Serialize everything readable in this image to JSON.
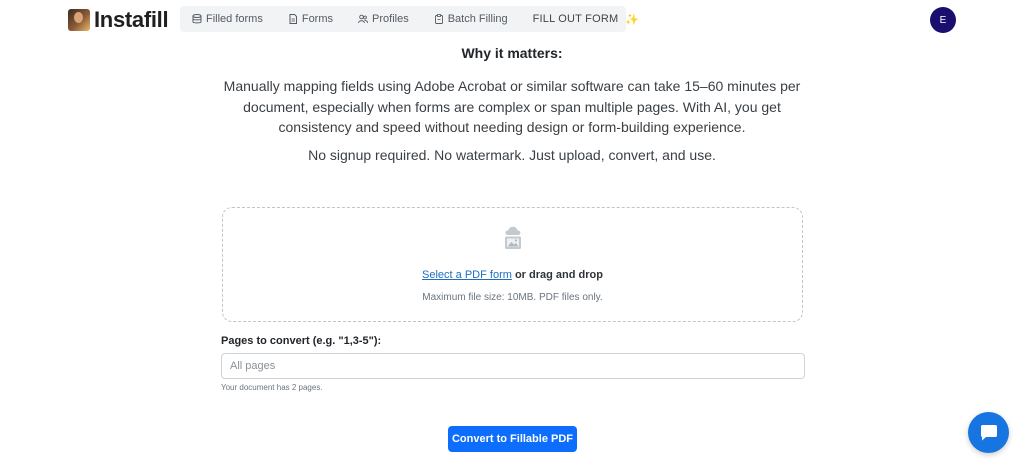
{
  "header": {
    "brand": "Instafill",
    "nav": [
      {
        "label": "Filled forms",
        "icon": "database-icon"
      },
      {
        "label": "Forms",
        "icon": "document-icon"
      },
      {
        "label": "Profiles",
        "icon": "people-icon"
      },
      {
        "label": "Batch Filling",
        "icon": "clipboard-icon"
      }
    ],
    "fill_out_form": "FILL OUT FORM",
    "fill_sparkle": "✨",
    "avatar_initial": "E"
  },
  "why": {
    "title": "Why it matters:",
    "body": "Manually mapping fields using Adobe Acrobat or similar software can take 15–60 minutes per document, especially when forms are complex or span multiple pages. With AI, you get consistency and speed without needing design or form-building experience.",
    "note": "No signup required. No watermark. Just upload, convert, and use."
  },
  "upload": {
    "select_link": "Select a PDF form",
    "select_rest": " or drag and drop",
    "max_size": "Maximum file size: 10MB. PDF files only."
  },
  "pages": {
    "label": "Pages to convert (e.g. \"1,3-5\"):",
    "placeholder": "All pages",
    "help": "Your document has 2 pages."
  },
  "actions": {
    "convert": "Convert to Fillable PDF"
  },
  "colors": {
    "primary": "#0d6efd",
    "avatar_bg": "#1a0f6e",
    "chat_bg": "#1675e0",
    "link": "#1b6ec2"
  }
}
